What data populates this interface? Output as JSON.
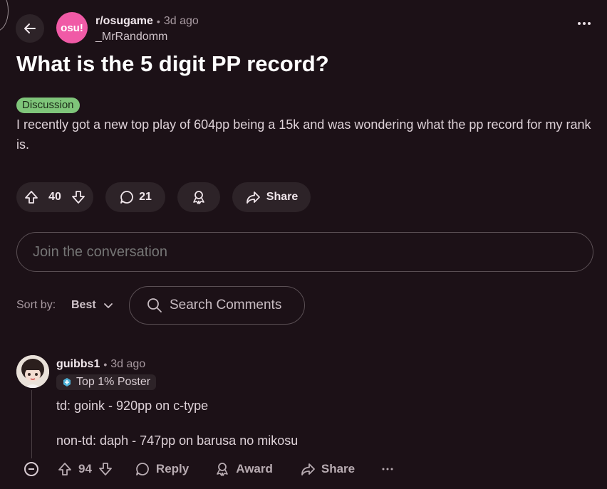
{
  "post": {
    "subreddit": "r/osugame",
    "subreddit_avatar_text": "osu!",
    "time": "3d ago",
    "separator": "•",
    "author": "_MrRandomm",
    "title": "What is the 5 digit PP record?",
    "flair": "Discussion",
    "body": "I recently got a new top play of 604pp being a 15k and was wondering what the pp record for my rank is.",
    "votes": "40",
    "comments": "21",
    "share_label": "Share"
  },
  "join": {
    "placeholder": "Join the conversation"
  },
  "sort": {
    "label": "Sort by:",
    "value": "Best"
  },
  "search": {
    "placeholder": "Search Comments"
  },
  "comment": {
    "author": "guibbs1",
    "time": "3d ago",
    "separator": "•",
    "badge": "Top 1% Poster",
    "line1": "td: goink - 920pp on c-type",
    "line2": "non-td: daph - 747pp on barusa no mikosu",
    "votes": "94",
    "reply_label": "Reply",
    "award_label": "Award",
    "share_label": "Share"
  },
  "colors": {
    "background": "#1c1117",
    "pill": "#2d2328",
    "subreddit_avatar": "#f05aa6",
    "flair": "#7fc57a"
  },
  "icons": [
    "arrow-left-icon",
    "more-icon",
    "upvote-icon",
    "downvote-icon",
    "comment-icon",
    "award-icon",
    "share-icon",
    "search-icon",
    "chevron-down-icon",
    "collapse-icon",
    "badge-icon"
  ]
}
